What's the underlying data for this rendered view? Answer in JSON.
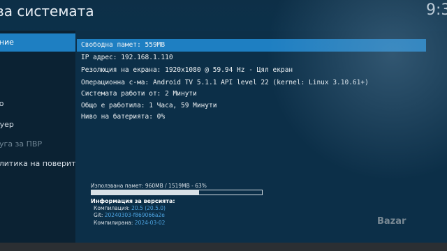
{
  "header": {
    "title": "ва системата",
    "clock": "9:3"
  },
  "sidebar": {
    "items": [
      {
        "label": "ение",
        "active": true
      },
      {
        "label": "а"
      },
      {
        "label": "ео"
      },
      {
        "label": "дуер"
      },
      {
        "label": "луга за ПВР",
        "dim": true
      },
      {
        "label": "олитика на поверите..."
      }
    ]
  },
  "info": {
    "lines": [
      "Свободна памет: 559MB",
      "IP адрес: 192.168.1.110",
      "Резолюция на екрана: 1920x1080 @ 59.94 Hz - Цял екран",
      "Операционна с-ма: Android TV 5.1.1 API level 22 (kernel: Linux 3.10.61+)",
      "Системата работи от: 2 Минути",
      "Общо е работила: 1 Часа, 59 Минути",
      "Ниво на батерията: 0%"
    ]
  },
  "memory": {
    "label": "Използвана памет: 960MB / 1519MB - 63%",
    "percent": 63
  },
  "version": {
    "title": "Информация за версията:",
    "rows": [
      {
        "key": "Компилация:",
        "value": "20.5 (20.5.0)"
      },
      {
        "key": "Git:",
        "value": "20240303-f869066a2e"
      },
      {
        "key": "Компилирана:",
        "value": "2024-03-02"
      }
    ]
  },
  "watermark": "Bazar",
  "colors": {
    "accent": "#1e7fc2",
    "panel": "#0c2f48",
    "link": "#4da3e0"
  }
}
